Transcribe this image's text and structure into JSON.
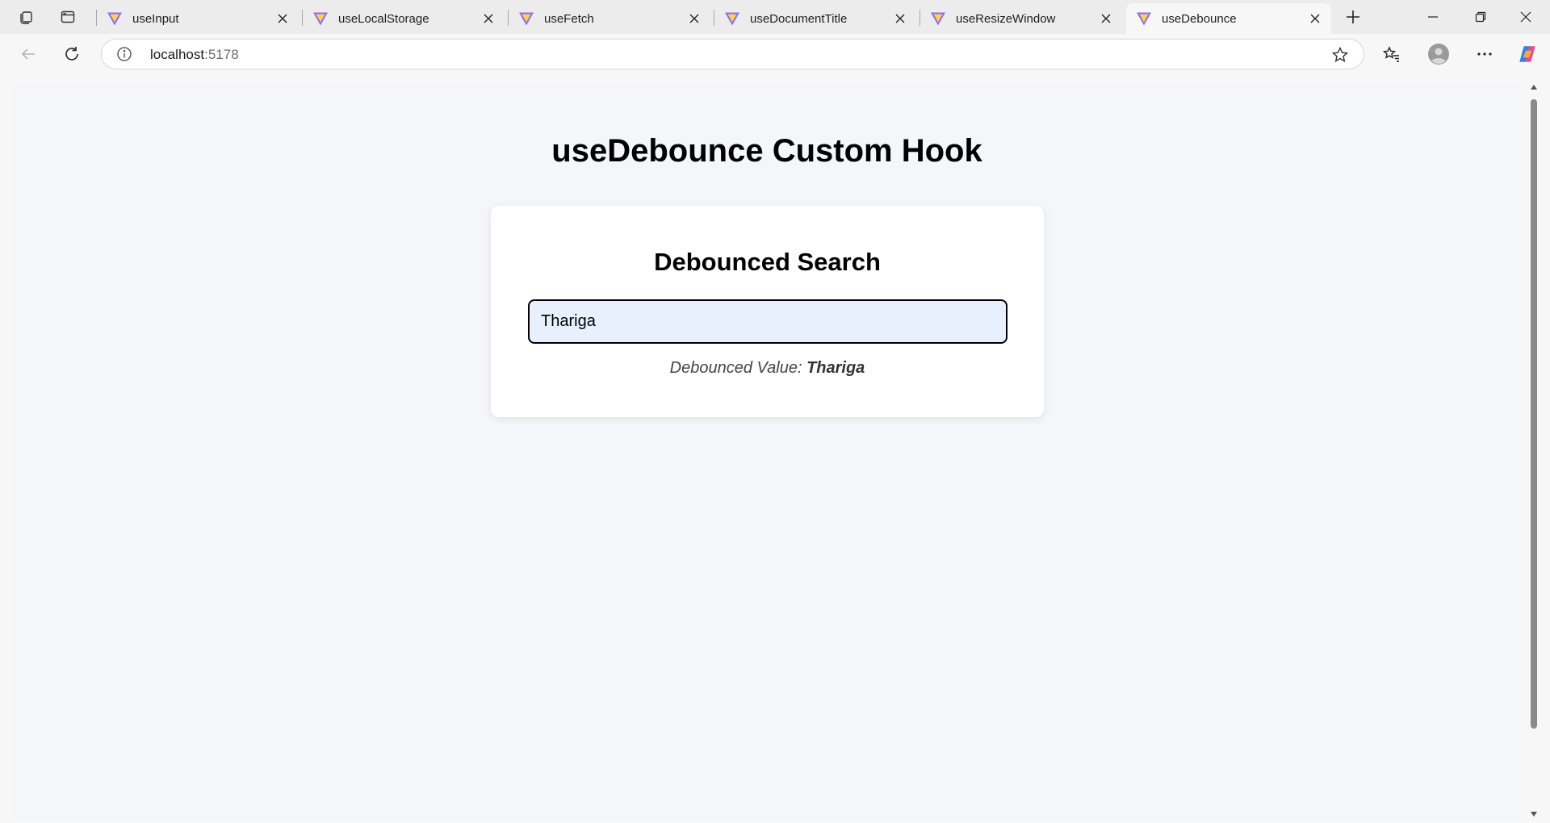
{
  "browser": {
    "tabs": [
      {
        "title": "useInput",
        "active": false
      },
      {
        "title": "useLocalStorage",
        "active": false
      },
      {
        "title": "useFetch",
        "active": false
      },
      {
        "title": "useDocumentTitle",
        "active": false
      },
      {
        "title": "useResizeWindow",
        "active": false
      },
      {
        "title": "useDebounce",
        "active": true
      }
    ],
    "address": {
      "host": "localhost",
      "port": ":5178"
    },
    "icons": {
      "workspaces": "workspaces-icon",
      "tab_actions": "tab-actions-icon",
      "favicon": "vite-favicon-icon",
      "close": "close-icon",
      "new_tab": "plus-icon",
      "minimize": "minimize-icon",
      "restore": "restore-icon",
      "window_close": "window-close-icon",
      "back": "back-arrow-icon",
      "refresh": "refresh-icon",
      "site_info": "info-icon",
      "favorite": "star-icon",
      "favorites": "favorites-icon",
      "profile": "profile-avatar-icon",
      "more": "more-icon",
      "copilot": "copilot-icon"
    }
  },
  "page": {
    "heading": "useDebounce Custom Hook",
    "card": {
      "title": "Debounced Search",
      "input_value": "Thariga",
      "debounced_label": "Debounced Value: ",
      "debounced_value": "Thariga"
    }
  },
  "colors": {
    "page_background": "#f5f6fa",
    "card_background": "#ffffff",
    "input_background": "#e8f0fe",
    "input_border": "#000000"
  }
}
